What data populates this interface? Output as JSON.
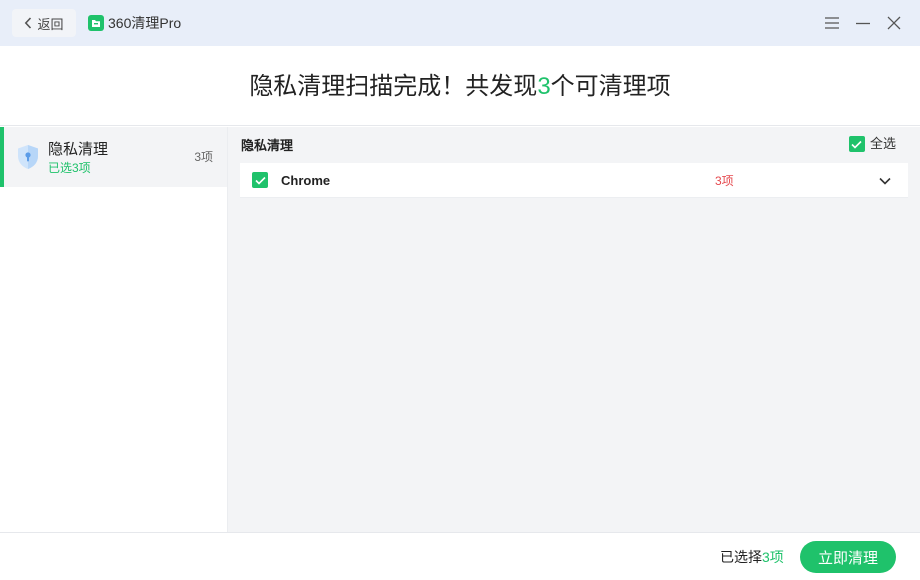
{
  "window": {
    "back_label": "返回",
    "app_title": "360清理Pro",
    "icons": [
      "chevron-left-icon",
      "app-logo-icon",
      "menu-icon",
      "minimize-icon",
      "close-icon"
    ]
  },
  "header": {
    "title_prefix": "隐私清理扫描完成！共发现",
    "count": "3",
    "title_suffix": "个可清理项"
  },
  "sidebar": {
    "items": [
      {
        "title": "隐私清理",
        "subtitle": "已选3项",
        "count": "3项",
        "icon": "shield-icon",
        "selected": true
      }
    ]
  },
  "panel": {
    "section_title": "隐私清理",
    "select_all_label": "全选",
    "select_all_checked": true,
    "rows": [
      {
        "name": "Chrome",
        "count": "3项",
        "checked": true,
        "icon": "chevron-down-icon"
      }
    ]
  },
  "footer": {
    "selected_prefix": "已选择",
    "selected_count": "3项",
    "clean_button": "立即清理"
  },
  "colors": {
    "accent": "#1fc26b",
    "titlebar_bg": "#e8eef9",
    "panel_bg": "#f3f4f6",
    "count_red": "#e5484d"
  }
}
